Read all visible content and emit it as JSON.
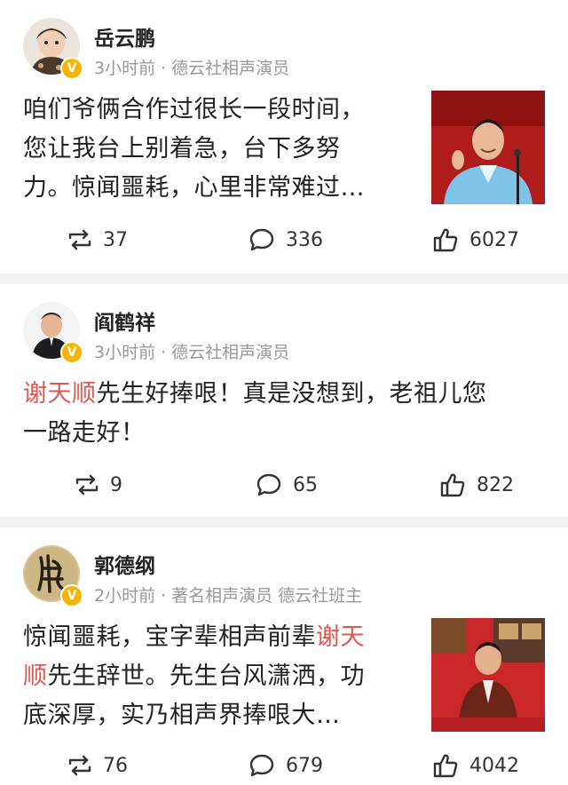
{
  "posts": [
    {
      "author": "岳云鹏",
      "time": "3小时前",
      "dot": "·",
      "tag": "德云社相声演员",
      "verified": "V",
      "lines": [
        {
          "segs": [
            {
              "t": "咱们爷俩合作过很长一段时间，",
              "hl": false
            }
          ]
        },
        {
          "segs": [
            {
              "t": "您让我台上别着急，台下多努",
              "hl": false
            }
          ]
        },
        {
          "segs": [
            {
              "t": "力。惊闻噩耗，心里非常难过…",
              "hl": false
            }
          ]
        }
      ],
      "reposts": "37",
      "comments": "336",
      "likes": "6027"
    },
    {
      "author": "阎鹤祥",
      "time": "3小时前",
      "dot": "·",
      "tag": "德云社相声演员",
      "verified": "V",
      "lines": [
        {
          "segs": [
            {
              "t": "谢天顺",
              "hl": true
            },
            {
              "t": "先生好捧哏！真是没想到，老祖儿您",
              "hl": false
            }
          ]
        },
        {
          "segs": [
            {
              "t": "一路走好！",
              "hl": false
            }
          ]
        }
      ],
      "reposts": "9",
      "comments": "65",
      "likes": "822"
    },
    {
      "author": "郭德纲",
      "time": "2小时前",
      "dot": "·",
      "tag": "著名相声演员 德云社班主",
      "verified": "V",
      "lines": [
        {
          "segs": [
            {
              "t": "惊闻噩耗，宝字辈相声前辈",
              "hl": false
            },
            {
              "t": "谢天",
              "hl": true
            }
          ]
        },
        {
          "segs": [
            {
              "t": "顺",
              "hl": true
            },
            {
              "t": "先生辞世。先生台风潇洒，功",
              "hl": false
            }
          ]
        },
        {
          "segs": [
            {
              "t": "底深厚，实乃相声界捧哏大…",
              "hl": false
            }
          ]
        }
      ],
      "reposts": "76",
      "comments": "679",
      "likes": "4042"
    }
  ],
  "colors": {
    "highlight": "#e0574f",
    "meta": "#999999",
    "badge": "#f7b500",
    "divider": "#f2f2f2"
  },
  "icons": {
    "repost": "repost-icon",
    "comment": "comment-icon",
    "like": "like-icon",
    "verified": "verified-badge-icon"
  }
}
